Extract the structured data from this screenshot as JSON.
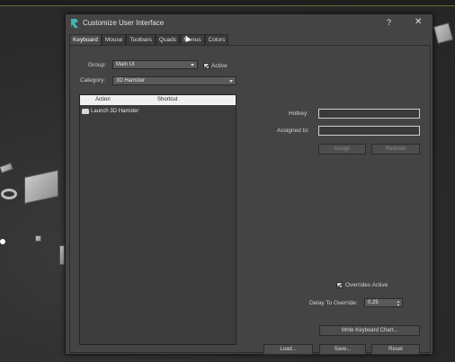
{
  "window": {
    "title": "Customize User Interface",
    "help_glyph": "?",
    "close_glyph": "✕",
    "icon": "app-logo-icon"
  },
  "tabs": [
    {
      "label": "Keyboard",
      "active": true
    },
    {
      "label": "Mouse",
      "active": false
    },
    {
      "label": "Toolbars",
      "active": false
    },
    {
      "label": "Quads",
      "active": false
    },
    {
      "label": "Menus",
      "active": false
    },
    {
      "label": "Colors",
      "active": false
    }
  ],
  "group": {
    "label": "Group:",
    "value": "Main UI",
    "active_label": "Active",
    "active_checked": true
  },
  "category": {
    "label": "Category:",
    "value": "3D Hamster"
  },
  "action_list": {
    "columns": [
      "Action",
      "Shortcut"
    ],
    "rows": [
      {
        "icon": "hamster-icon",
        "action": "Launch 3D Hamster",
        "shortcut": ""
      }
    ]
  },
  "hotkey": {
    "label": "Hotkey:",
    "value": ""
  },
  "assigned_to": {
    "label": "Assigned to:",
    "value": ""
  },
  "buttons": {
    "assign": "Assign",
    "remove": "Remove",
    "write_chart": "Write Keyboard Chart...",
    "load": "Load...",
    "save": "Save...",
    "reset": "Reset"
  },
  "overrides": {
    "label": "Overrides Active",
    "checked": true
  },
  "delay": {
    "label": "Delay To Override:",
    "value": "0,25"
  },
  "colors": {
    "dialog_bg": "#444444",
    "viewport_bg": "#2e2e2e",
    "list_header_bg": "#f0f0f0"
  }
}
